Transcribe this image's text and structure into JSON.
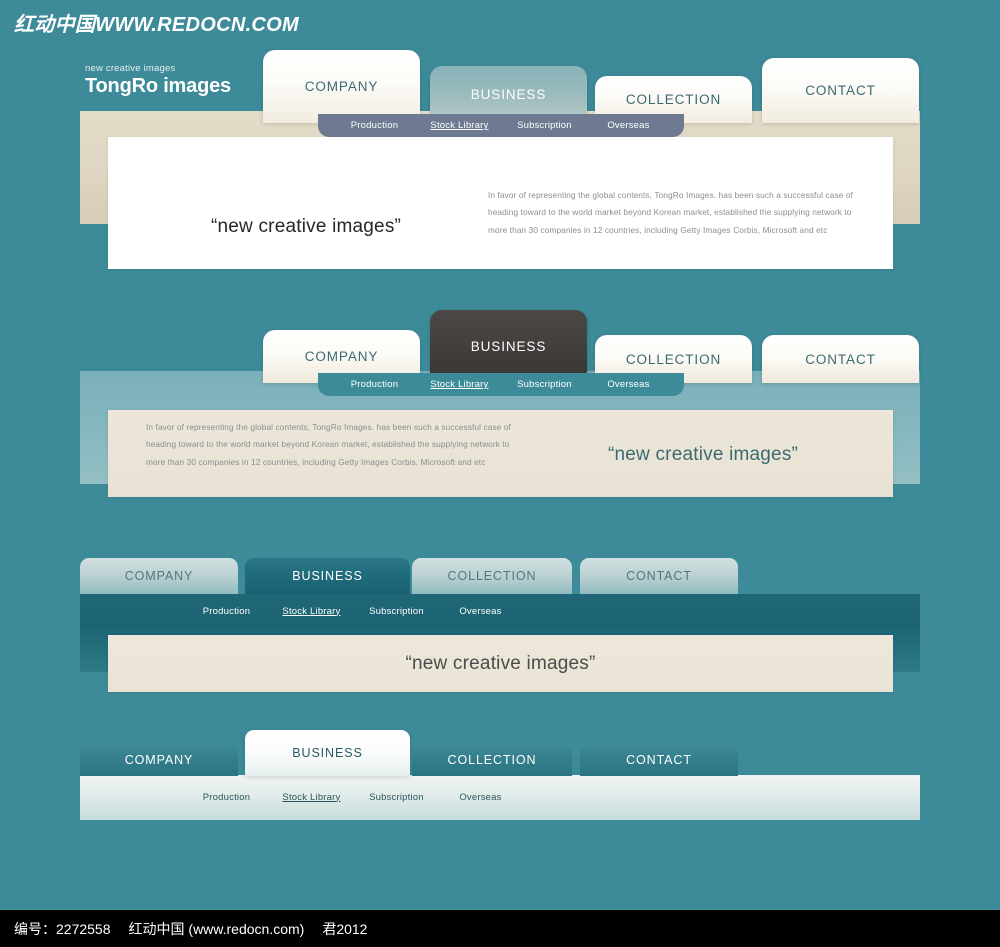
{
  "watermark": "红动中国WWW.REDOCN.COM",
  "logo": {
    "sub": "new creative images",
    "main": "TongRo images"
  },
  "page_background": "#3d8b99",
  "tagline": "“new creative images”",
  "body_text": "In favor of representing the global contents, TongRo Images. has been such a successful case of heading toward to the world market beyond Korean market, established the supplying network to more than 30 companies in 12 countries, including Getty Images Corbis, Microsoft and etc",
  "tabs": {
    "company": "COMPANY",
    "business": "BUSINESS",
    "collection": "COLLECTION",
    "contact": "CONTACT"
  },
  "submenu": {
    "production": "Production",
    "stock_library": "Stock Library",
    "subscription": "Subscription",
    "overseas": "Overseas",
    "active": "Stock Library"
  },
  "sections": [
    {
      "id": "sec1",
      "name": "beige-variant",
      "active_tab": "BUSINESS",
      "backdrop_color": "#ded6c2",
      "panel_color": "#ffffff",
      "submenu_bar_color": "#6d7a91",
      "tagline_color": "#262626",
      "tagline_align": "left",
      "text_align": "right"
    },
    {
      "id": "sec2",
      "name": "blue-variant",
      "active_tab": "BUSINESS",
      "backdrop_color": "#85b6bf",
      "panel_color": "#e8e2d4",
      "submenu_bar_color": "#3d8b99",
      "tagline_color": "#3c6a72",
      "tagline_align": "right",
      "text_align": "left"
    },
    {
      "id": "sec3",
      "name": "dark-teal-variant",
      "active_tab": "BUSINESS",
      "backdrop_color": "#1c6474",
      "panel_color": "#e9e3d5",
      "submenu_bar_color": "#1c6474",
      "tagline_color": "#4c4c4a",
      "tagline_align": "center",
      "text_align": "none"
    },
    {
      "id": "sec4",
      "name": "light-bar-variant",
      "active_tab": "BUSINESS",
      "backdrop_color": "#e2eceb",
      "panel_color": "none",
      "submenu_bar_color": "#e2eceb",
      "tagline_color": "none",
      "tagline_align": "none",
      "text_align": "none"
    }
  ],
  "footer": {
    "code": "编号：2272558",
    "site": "红动中国 (www.redocn.com)",
    "author": "君2012"
  }
}
